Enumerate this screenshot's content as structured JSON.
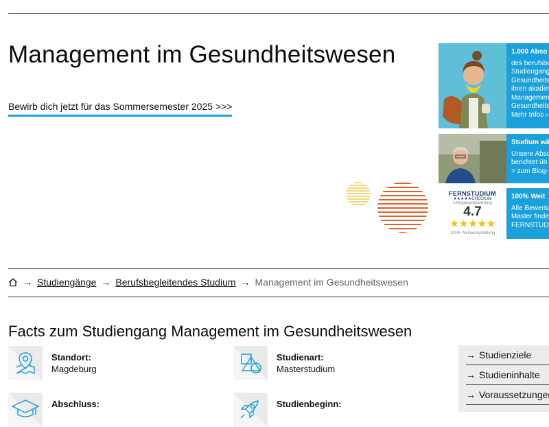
{
  "hero": {
    "title": "Management im Gesundheitswesen",
    "cta": "Bewirb dich jetzt für das Sommersemester 2025 >>>"
  },
  "cards": [
    {
      "headline": "1.000 Abso",
      "lines": [
        "des berufsbe",
        "Studiengang",
        "Gesundheits",
        "ihren akaden",
        "Managemen",
        "Gesundheits",
        "Mehr Infos ›"
      ]
    },
    {
      "headline": "Studium wä",
      "lines": [
        "Unsere Abso",
        "berichtet üb",
        "> zum Blog-"
      ]
    },
    {
      "headline": "100% Weit",
      "lines": [
        "Alle Bewertu",
        "Master finde",
        "FERNSTUDI"
      ],
      "rating": {
        "brand": "FERNSTUDIUM",
        "brand_sub": "★★★★★CHECK.de",
        "caption": "Lehrgangsbewertung",
        "score": "4.7",
        "stars": "★★★★★",
        "footer": "100% Weiterempfehlung"
      }
    }
  ],
  "breadcrumb": {
    "home_icon": "home-icon",
    "items": [
      "Studiengänge",
      "Berufsbegleitendes Studium"
    ],
    "current": "Management im Gesundheitswesen"
  },
  "facts": {
    "title": "Facts zum Studiengang Management im Gesundheitswesen",
    "items": [
      {
        "label": "Standort:",
        "value": "Magdeburg",
        "icon": "location-map-icon"
      },
      {
        "label": "Studienart:",
        "value": "Masterstudium",
        "icon": "shapes-icon"
      },
      {
        "label": "Abschluss:",
        "value": "",
        "icon": "graduation-cap-icon"
      },
      {
        "label": "Studienbeginn:",
        "value": "",
        "icon": "rocket-icon"
      }
    ]
  },
  "side_nav": {
    "items": [
      "Studienziele",
      "Studieninhalte",
      "Voraussetzungen"
    ]
  },
  "colors": {
    "accent": "#1ba0d8",
    "deco_yellow": "#f2c94c",
    "deco_orange": "#e0602a"
  }
}
